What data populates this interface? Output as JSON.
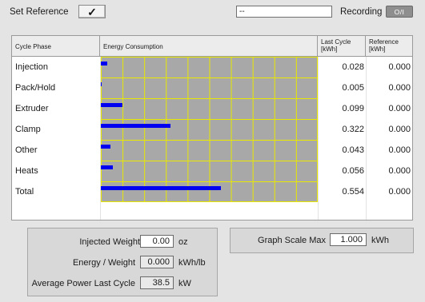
{
  "top_bar": {
    "set_reference_label": "Set Reference",
    "set_reference_button": "✓",
    "text_field_value": "--",
    "recording_label": "Recording",
    "recording_toggle": "O/I"
  },
  "table": {
    "headers": {
      "phase": "Cycle Phase",
      "energy": "Energy Consumption",
      "last_cycle_line1": "Last Cycle",
      "last_cycle_line2": "[kWh]",
      "reference_line1": "Reference",
      "reference_line2": "[kWh]"
    },
    "rows": [
      {
        "phase": "Injection",
        "last": "0.028",
        "ref": "0.000",
        "value": 0.028
      },
      {
        "phase": "Pack/Hold",
        "last": "0.005",
        "ref": "0.000",
        "value": 0.005
      },
      {
        "phase": "Extruder",
        "last": "0.099",
        "ref": "0.000",
        "value": 0.099
      },
      {
        "phase": "Clamp",
        "last": "0.322",
        "ref": "0.000",
        "value": 0.322
      },
      {
        "phase": "Other",
        "last": "0.043",
        "ref": "0.000",
        "value": 0.043
      },
      {
        "phase": "Heats",
        "last": "0.056",
        "ref": "0.000",
        "value": 0.056
      },
      {
        "phase": "Total",
        "last": "0.554",
        "ref": "0.000",
        "value": 0.554
      }
    ],
    "scale_max": 1.0
  },
  "bottom_left": {
    "injected_weight_label": "Injected Weight",
    "injected_weight_value": "0.00",
    "injected_weight_unit": "oz",
    "energy_weight_label": "Energy / Weight",
    "energy_weight_value": "0.000",
    "energy_weight_unit": "kWh/lb",
    "avg_power_label": "Average Power Last Cycle",
    "avg_power_value": "38.5",
    "avg_power_unit": "kW"
  },
  "bottom_right": {
    "graph_scale_label": "Graph Scale Max",
    "graph_scale_value": "1.000",
    "graph_scale_unit": "kWh"
  }
}
